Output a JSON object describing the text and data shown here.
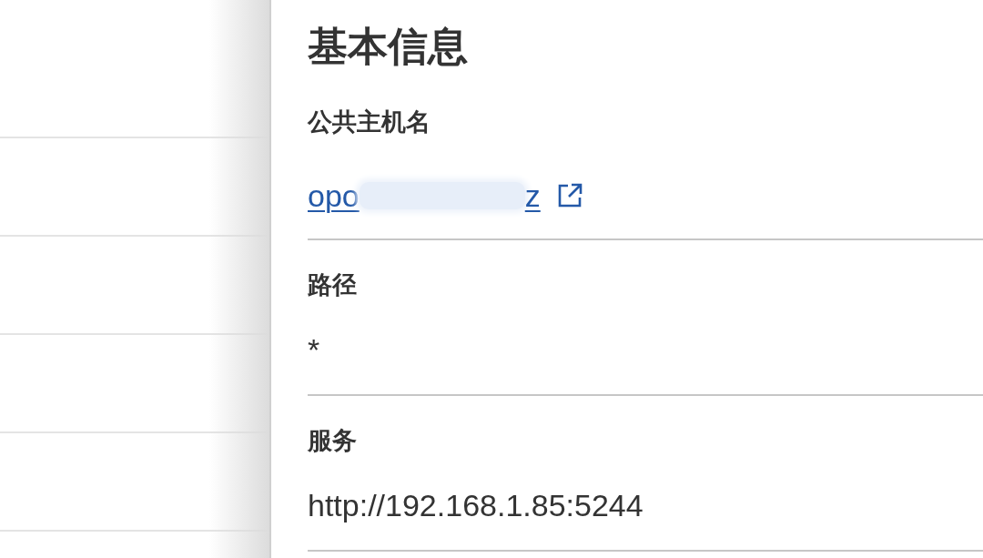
{
  "panel": {
    "title": "基本信息",
    "fields": [
      {
        "kind": "link",
        "label": "公共主机名",
        "value_start": "opo",
        "value_end": "z"
      },
      {
        "kind": "text",
        "label": "路径",
        "value": "*"
      },
      {
        "kind": "text",
        "label": "服务",
        "value": "http://192.168.1.85:5244"
      }
    ]
  }
}
